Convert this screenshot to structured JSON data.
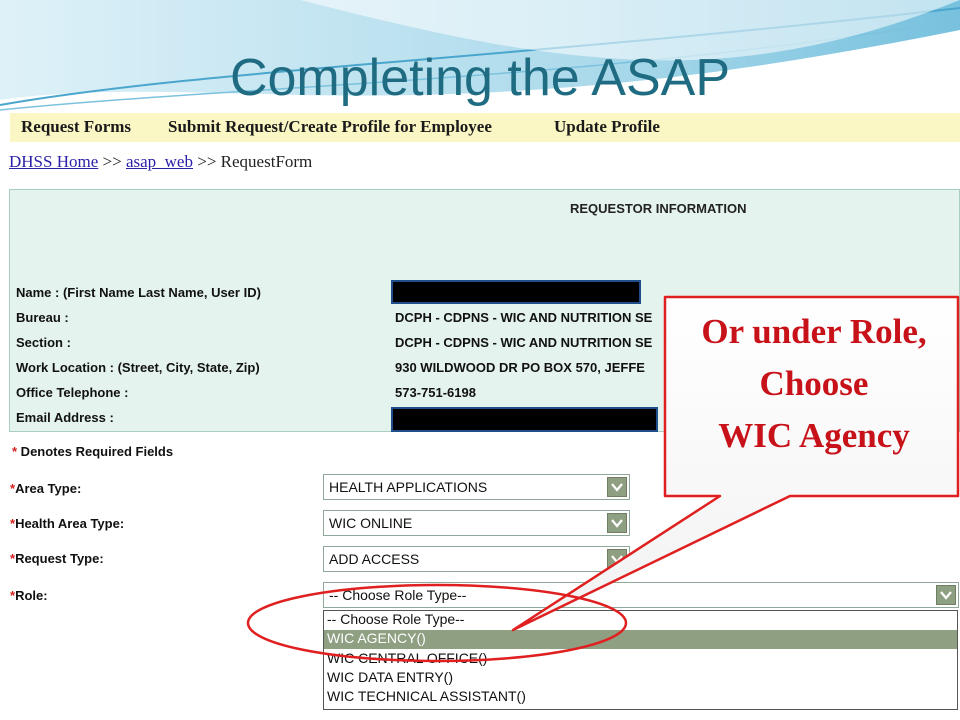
{
  "slide": {
    "title": "Completing the ASAP"
  },
  "menu": {
    "items": [
      "Request Forms",
      "Submit Request/Create Profile for Employee",
      "Update Profile"
    ]
  },
  "breadcrumb": {
    "home": "DHSS Home",
    "sep": ">>",
    "section": "asap_web",
    "current": "RequestForm"
  },
  "requestor": {
    "header": "REQUESTOR INFORMATION",
    "labels": {
      "name": "Name : (First Name Last Name,  User ID)",
      "bureau": "Bureau :",
      "section": "Section :",
      "location": "Work Location : (Street, City, State, Zip)",
      "phone": "Office Telephone :",
      "email": "Email Address :"
    },
    "values": {
      "bureau": "DCPH - CDPNS - WIC AND NUTRITION SE",
      "section": "DCPH - CDPNS - WIC AND NUTRITION SE",
      "location": "930 WILDWOOD DR PO BOX 570, JEFFE",
      "phone": "573-751-6198"
    }
  },
  "form": {
    "required_star": "*",
    "required_note": " Denotes Required Fields",
    "area_type": {
      "label": "Area Type:",
      "value": "HEALTH APPLICATIONS"
    },
    "health_area_type": {
      "label": "Health Area Type:",
      "value": "WIC ONLINE"
    },
    "request_type": {
      "label": "Request Type:",
      "value": "ADD ACCESS"
    },
    "role": {
      "label": "Role:",
      "value": "-- Choose Role Type--",
      "options": [
        "-- Choose Role Type--",
        "WIC AGENCY()",
        "WIC CENTRAL OFFICE()",
        "WIC DATA ENTRY()",
        "WIC TECHNICAL ASSISTANT()"
      ],
      "highlighted_index": 1
    }
  },
  "callout": {
    "line1": "Or under Role,",
    "line2": "Choose",
    "line3": "WIC Agency"
  },
  "colors": {
    "title": "#1f6c82",
    "callout": "#c8121a",
    "menubar": "#fbf7c4",
    "panel": "#e5f3ee",
    "selected": "#8f9f82"
  }
}
